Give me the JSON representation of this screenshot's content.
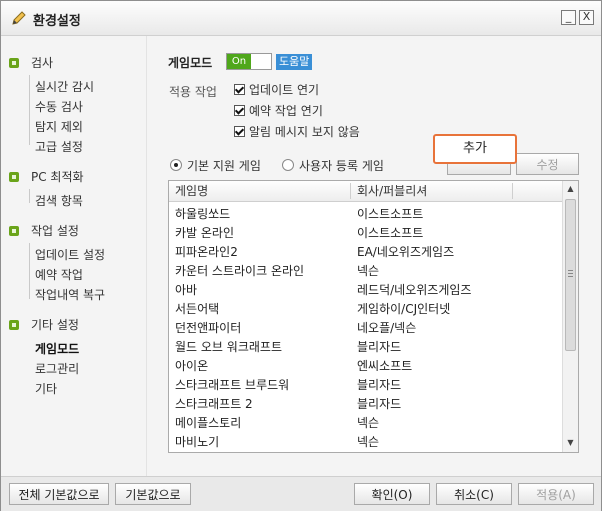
{
  "window": {
    "title": "환경설정",
    "minimize_label": "_",
    "close_label": "X"
  },
  "sidebar": {
    "groups": [
      {
        "label": "검사",
        "items": [
          "실시간 감시",
          "수동 검사",
          "탐지 제외",
          "고급 설정"
        ]
      },
      {
        "label": "PC 최적화",
        "items": [
          "검색 항목"
        ]
      },
      {
        "label": "작업 설정",
        "items": [
          "업데이트 설정",
          "예약 작업",
          "작업내역 복구"
        ]
      },
      {
        "label": "기타 설정",
        "items": [
          "게임모드",
          "로그관리",
          "기타"
        ]
      }
    ]
  },
  "main": {
    "title": "게임모드",
    "toggle_label": "On",
    "help_label": "도움말",
    "apply_label": "적용 작업",
    "checkboxes": [
      "업데이트 연기",
      "예약 작업 연기",
      "알림 메시지 보지 않음"
    ],
    "radios": [
      "기본 지원 게임",
      "사용자 등록 게임"
    ],
    "add_popup": "추가",
    "edit_button": "수정",
    "columns": [
      "게임명",
      "회사/퍼블리셔"
    ],
    "rows": [
      {
        "game": "하울링쏘드",
        "publisher": "이스트소프트"
      },
      {
        "game": "카발 온라인",
        "publisher": "이스트소프트"
      },
      {
        "game": "피파온라인2",
        "publisher": "EA/네오위즈게임즈"
      },
      {
        "game": "카운터 스트라이크 온라인",
        "publisher": "넥슨"
      },
      {
        "game": "아바",
        "publisher": "레드덕/네오위즈게임즈"
      },
      {
        "game": "서든어택",
        "publisher": "게임하이/CJ인터넷"
      },
      {
        "game": "던전앤파이터",
        "publisher": "네오플/넥슨"
      },
      {
        "game": "월드 오브 워크래프트",
        "publisher": "블리자드"
      },
      {
        "game": "아이온",
        "publisher": "엔씨소프트"
      },
      {
        "game": "스타크래프트 브루드워",
        "publisher": "블리자드"
      },
      {
        "game": "스타크래프트 2",
        "publisher": "블리자드"
      },
      {
        "game": "메이플스토리",
        "publisher": "넥슨"
      },
      {
        "game": "마비노기",
        "publisher": "넥슨"
      }
    ]
  },
  "footer": {
    "reset_all": "전체 기본값으로",
    "reset": "기본값으로",
    "ok": "확인(O)",
    "cancel": "취소(C)",
    "apply": "적용(A)"
  },
  "colors": {
    "accent_green": "#6aa41a",
    "toggle_green": "#4fa71b",
    "help_blue": "#3a8fd6",
    "popup_border": "#e8733a"
  }
}
